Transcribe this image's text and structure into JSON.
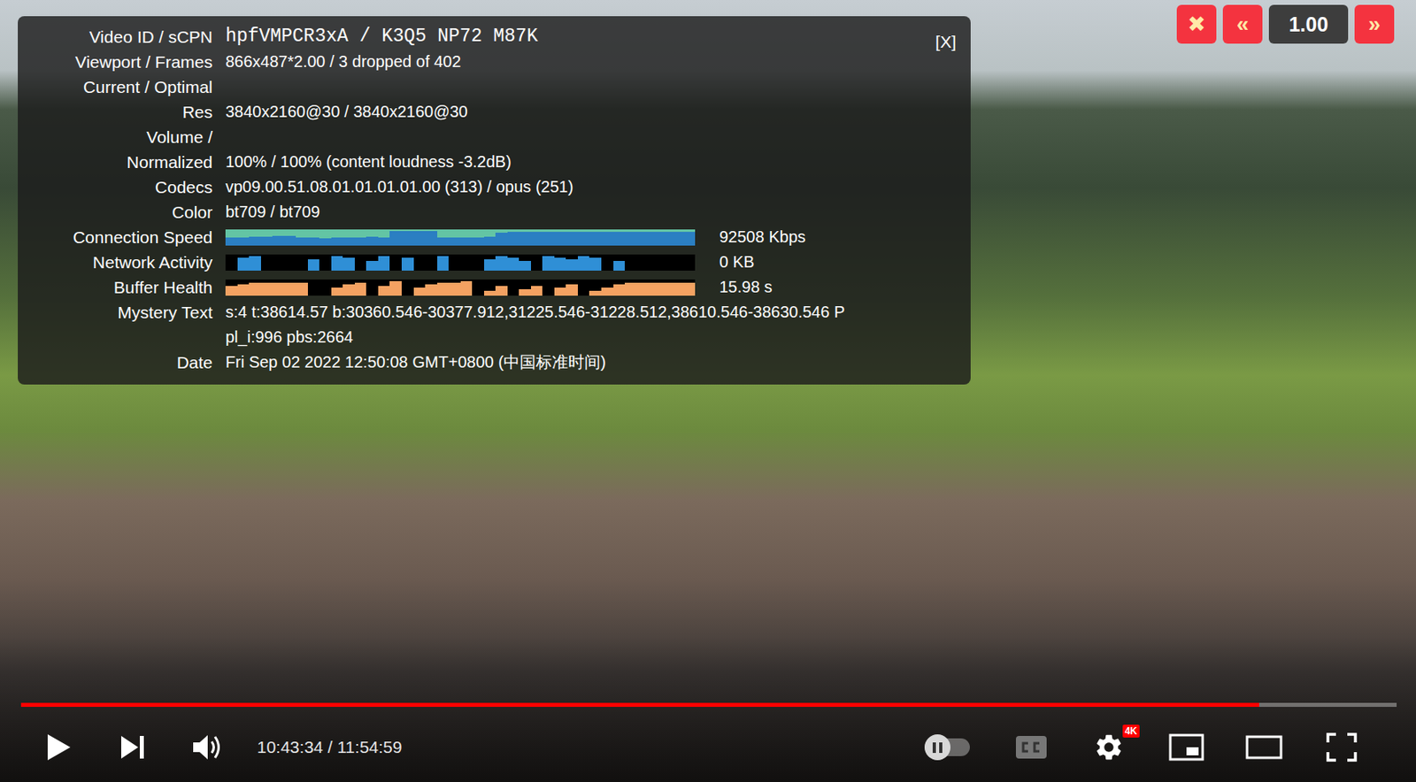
{
  "stats_panel": {
    "close": "[X]",
    "rows": [
      {
        "label": [
          "Video ID / sCPN"
        ],
        "kind": "mono-text",
        "value": [
          "hpfVMPCR3xA / K3Q5 NP72 M87K"
        ]
      },
      {
        "label": [
          "Viewport / Frames"
        ],
        "kind": "text",
        "value": [
          "866x487*2.00 / 3 dropped of 402"
        ]
      },
      {
        "label": [
          "Current / Optimal",
          "Res"
        ],
        "kind": "text",
        "value": [
          "3840x2160@30 / 3840x2160@30"
        ]
      },
      {
        "label": [
          "Volume /",
          "Normalized"
        ],
        "kind": "text",
        "value": [
          "100% / 100% (content loudness -3.2dB)"
        ]
      },
      {
        "label": [
          "Codecs"
        ],
        "kind": "text",
        "value": [
          "vp09.00.51.08.01.01.01.01.00 (313) / opus (251)"
        ]
      },
      {
        "label": [
          "Color"
        ],
        "kind": "text",
        "value": [
          "bt709 / bt709"
        ]
      },
      {
        "label": [
          "Connection Speed"
        ],
        "kind": "speed-graph",
        "reading": "92508 Kbps",
        "values": [
          0.5,
          0.5,
          0.55,
          0.55,
          0.6,
          0.6,
          0.5,
          0.5,
          0.45,
          0.5,
          0.5,
          0.5,
          0.55,
          0.5,
          0.9,
          0.9,
          0.9,
          0.9,
          0.5,
          0.5,
          0.5,
          0.5,
          0.55,
          0.8,
          0.85,
          0.85,
          0.85,
          0.85,
          0.85,
          0.85,
          0.85,
          0.85,
          0.85,
          0.85,
          0.85,
          0.85,
          0.85,
          0.85,
          0.85,
          0.85
        ]
      },
      {
        "label": [
          "Network Activity"
        ],
        "kind": "activity-graph",
        "reading": "0 KB",
        "values": [
          0,
          0.8,
          0.9,
          0,
          0,
          0,
          0,
          0.7,
          0,
          0.9,
          0.8,
          0,
          0.6,
          0.9,
          0,
          0.8,
          0,
          0,
          0.9,
          0,
          0,
          0,
          0.7,
          0.9,
          0.8,
          0.6,
          0,
          0.9,
          0.8,
          0.7,
          0.9,
          0.8,
          0,
          0.6,
          0,
          0,
          0,
          0,
          0,
          0
        ]
      },
      {
        "label": [
          "Buffer Health"
        ],
        "kind": "buffer-graph",
        "reading": "15.98 s",
        "values": [
          0.6,
          0.7,
          0.8,
          0.8,
          0.8,
          0.8,
          0.8,
          0,
          0,
          0.5,
          0.7,
          0.8,
          0,
          0.6,
          0.9,
          0,
          0.5,
          0.7,
          0.8,
          0.8,
          0.9,
          0,
          0.3,
          0.6,
          0,
          0.4,
          0.6,
          0,
          0.5,
          0.7,
          0,
          0.3,
          0.5,
          0.7,
          0.8,
          0.8,
          0.8,
          0.8,
          0.8,
          0.8
        ]
      },
      {
        "label": [
          "Mystery Text"
        ],
        "kind": "text",
        "value": [
          "s:4 t:38614.57 b:30360.546-30377.912,31225.546-31228.512,38610.546-38630.546 P",
          "pl_i:996 pbs:2664"
        ]
      },
      {
        "label": [
          "Date"
        ],
        "kind": "text",
        "value": [
          "Fri Sep 02 2022 12:50:08 GMT+0800 (中国标准时间)"
        ]
      }
    ]
  },
  "speed_controls": [
    {
      "label": "✖",
      "kind": "button"
    },
    {
      "label": "«",
      "kind": "button"
    },
    {
      "label": "1.00",
      "kind": "readout"
    },
    {
      "label": "»",
      "kind": "button"
    }
  ],
  "player": {
    "progress_level": 0.9,
    "time": "10:43:34 / 11:54:59",
    "autoplay_on": false,
    "settings_badge": "4K"
  }
}
